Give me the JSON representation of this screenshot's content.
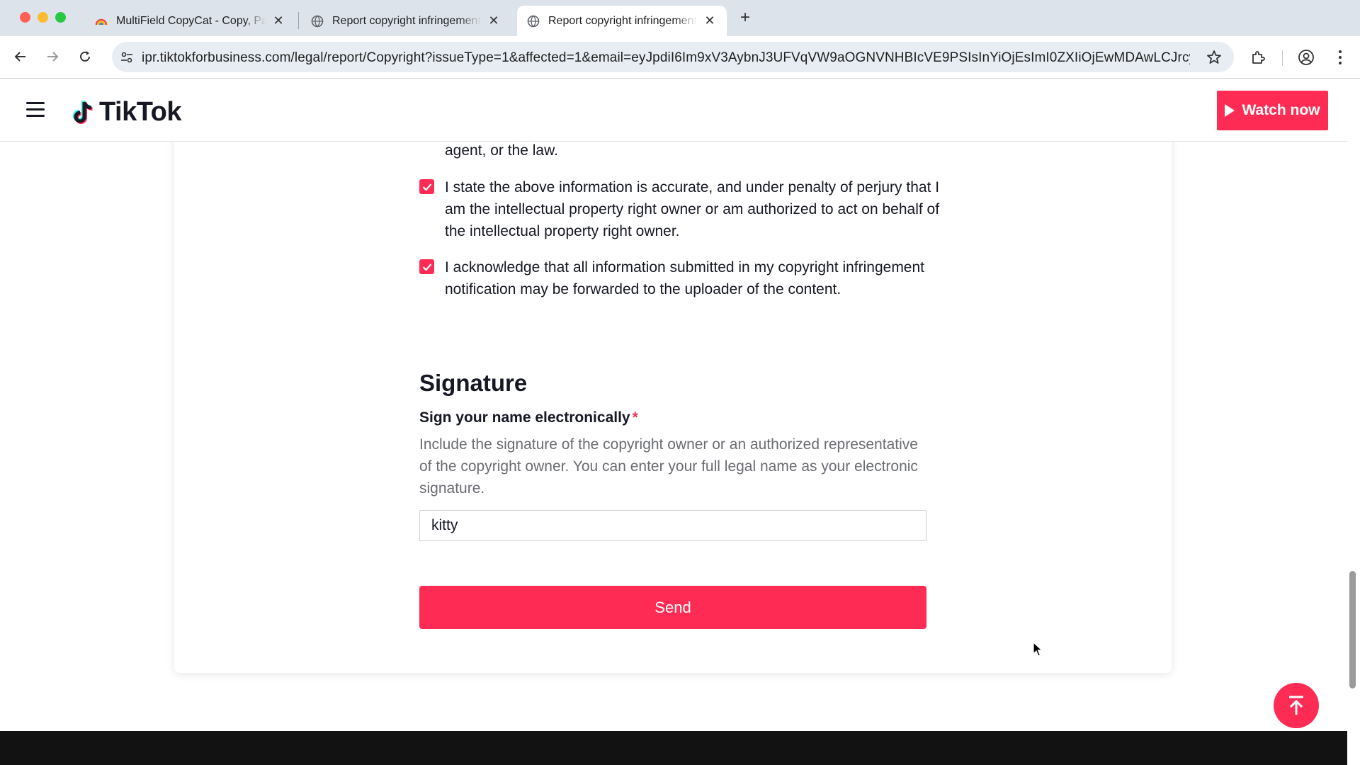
{
  "browser": {
    "tabs": [
      {
        "title": "MultiField CopyCat - Copy, Paste",
        "active": false
      },
      {
        "title": "Report copyright infringement",
        "active": false
      },
      {
        "title": "Report copyright infringement",
        "active": true
      }
    ],
    "close_glyph": "✕",
    "new_tab_glyph": "+",
    "url": "ipr.tiktokforbusiness.com/legal/report/Copyright?issueType=1&affected=1&email=eyJpdiI6Im9xV3AybnJ3UFVqVW9aOGNVNHBIcVE9PSIsInYiOjEsImI0ZXIiOjEwMDAwLCJrcyI6..."
  },
  "header": {
    "logo_text": "TikTok",
    "watch_now_label": "Watch now"
  },
  "form": {
    "continued_text": "agent, or the law.",
    "checkboxes": [
      {
        "label": "I state the above information is accurate, and under penalty of perjury that I am the intellectual property right owner or am authorized to act on behalf of the intellectual property right owner.",
        "checked": true
      },
      {
        "label": "I acknowledge that all information submitted in my copyright infringement notification may be forwarded to the uploader of the content.",
        "checked": true
      }
    ],
    "signature": {
      "title": "Signature",
      "label": "Sign your name electronically",
      "required_mark": "*",
      "description": "Include the signature of the copyright owner or an authorized representative of the copyright owner. You can enter your full legal name as your electronic signature.",
      "value": "kitty"
    },
    "send_label": "Send"
  },
  "colors": {
    "brand": "#fe2c55",
    "text": "#161823",
    "muted": "#6b6c73"
  },
  "icons": [
    "back-arrow-icon",
    "forward-arrow-icon",
    "reload-icon",
    "site-settings-icon",
    "bookmark-star-icon",
    "extensions-icon",
    "profile-icon",
    "more-menu-icon",
    "hamburger-icon",
    "tiktok-logo-icon",
    "play-icon",
    "check-icon",
    "scroll-top-icon",
    "mouse-cursor-icon"
  ]
}
